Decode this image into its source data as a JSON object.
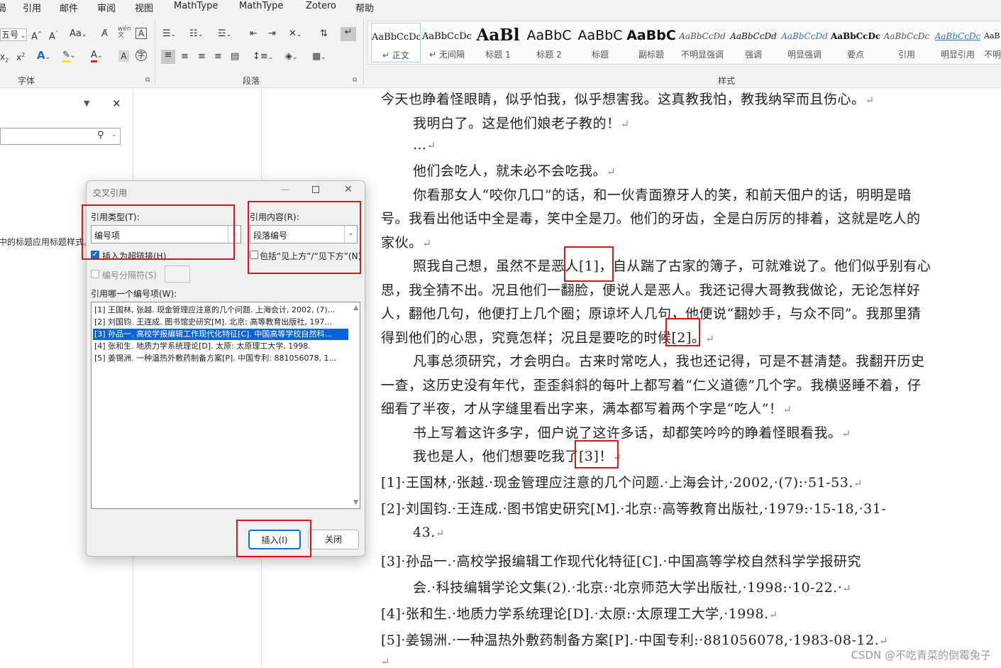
{
  "menu": {
    "m0": "引用",
    "m1": "邮件",
    "m2": "审阅",
    "m3": "视图",
    "m4": "MathType",
    "m5": "MathType",
    "m6": "Zotero",
    "m7": "帮助",
    "partial": "局"
  },
  "ribbon": {
    "font_size_value": "五号",
    "groups": {
      "font": "字体",
      "paragraph": "段落",
      "styles": "样式"
    },
    "styles": [
      {
        "sample": "AaBbCcDc",
        "name": "↵ 正文"
      },
      {
        "sample": "AaBbCcDc",
        "name": "↵ 无间隔"
      },
      {
        "sample": "AaBl",
        "name": "标题 1"
      },
      {
        "sample": "AaBbC",
        "name": "标题 2"
      },
      {
        "sample": "AaBbC",
        "name": "标题"
      },
      {
        "sample": "AaBbC",
        "name": "副标题"
      },
      {
        "sample": "AaBbCcDd",
        "name": "不明显强调"
      },
      {
        "sample": "AaBbCcDd",
        "name": "强调"
      },
      {
        "sample": "AaBbCcDd",
        "name": "明显强调"
      },
      {
        "sample": "AaBbCcDc",
        "name": "要点"
      },
      {
        "sample": "AaBbCcDc",
        "name": "引用"
      },
      {
        "sample": "AaBbCcDc",
        "name": "明显引用"
      },
      {
        "sample": "AaB",
        "name": "不明"
      }
    ]
  },
  "navpane": {
    "hint": "中的标题应用标题样式。"
  },
  "dialog": {
    "title": "交叉引用",
    "ref_type_label": "引用类型(T):",
    "ref_type_value": "编号项",
    "ref_content_label": "引用内容(R):",
    "ref_content_value": "段落编号",
    "insert_hyperlink": "插入为超链接(H)",
    "include_above_below": "包括“见上方”/“见下方”(N)",
    "separator": "编号分隔符(S)",
    "which_label": "引用哪一个编号项(W):",
    "items": [
      "[1] 王国林, 张越. 现金管理应注意的几个问题. 上海会计, 2002, (7)...",
      "[2] 刘国钧. 王连成. 图书馆史研究[M]. 北京: 高等教育出版社, 197...",
      "[3] 孙品一. 高校学报编辑工作现代化特征[C]. 中国高等学校自然科...",
      "[4] 张和生. 地质力学系统理论[D]. 太原: 太原理工大学, 1998.",
      "[5] 姜锡洲. 一种温热外敷药制备方案[P]. 中国专利: 881056078, 1..."
    ],
    "insert_button": "插入(I)",
    "close_button": "关闭"
  },
  "document": {
    "lines": [
      "今天也睁着怪眼睛，似乎怕我，似乎想害我。这真教我怕，教我纳罕而且伤心。",
      "我明白了。这是他们娘老子教的！",
      "…",
      "他们会吃人，就未必不会吃我。",
      "你看那女人“咬你几口”的话，和一伙青面獠牙人的笑，和前天佃户的话，明明是暗",
      "号。我看出他话中全是毒，笑中全是刀。他们的牙齿，全是白厉厉的排着，这就是吃人的",
      "家伙。",
      "照我自己想，虽然不是恶人[1]，自从踹了古家的簿子，可就难说了。他们似乎别有心",
      "思，我全猜不出。况且他们一翻脸，便说人是恶人。我还记得大哥教我做论，无论怎样好",
      "人，翻他几句，他便打上几个圈；原谅坏人几句，他便说“翻妙手，与众不同”。我那里猜",
      "得到他们的心思，究竟怎样；况且是要吃的时候[2]。",
      "凡事总须研究，才会明白。古来时常吃人，我也还记得，可是不甚清楚。我翻开历史",
      "一查，这历史没有年代，歪歪斜斜的每叶上都写着“仁义道德”几个字。我横竖睡不着，仔",
      "细看了半夜，才从字缝里看出字来，满本都写着两个字是“吃人”！",
      "书上写着这许多字，佃户说了这许多话，却都笑吟吟的睁着怪眼看我。",
      "我也是人，他们想要吃我了[3]！"
    ],
    "refs": [
      "[1]·王国林,·张越.·现金管理应注意的几个问题.·上海会计,·2002,·(7):·51-53.",
      "[2]·刘国钧.·王连成.·图书馆史研究[M].·北京:·高等教育出版社,·1979:·15-18,·31-",
      "43.",
      "[3]·孙品一.·高校学报编辑工作现代化特征[C].·中国高等学校自然科学学报研究",
      "会.·科技编辑学论文集(2).·北京:·北京师范大学出版社,·1998:·10-22.·",
      "[4]·张和生.·地质力学系统理论[D].·太原:·太原理工大学,·1998.",
      "[5]·姜锡洲.·一种温热外敷药制备方案[P].·中国专利:·881056078,·1983-08-12."
    ]
  },
  "watermark": "CSDN @不吃青菜的倒霉兔子",
  "colors": {
    "highlight_box": "#d9141b",
    "selection": "#0a64d8"
  }
}
